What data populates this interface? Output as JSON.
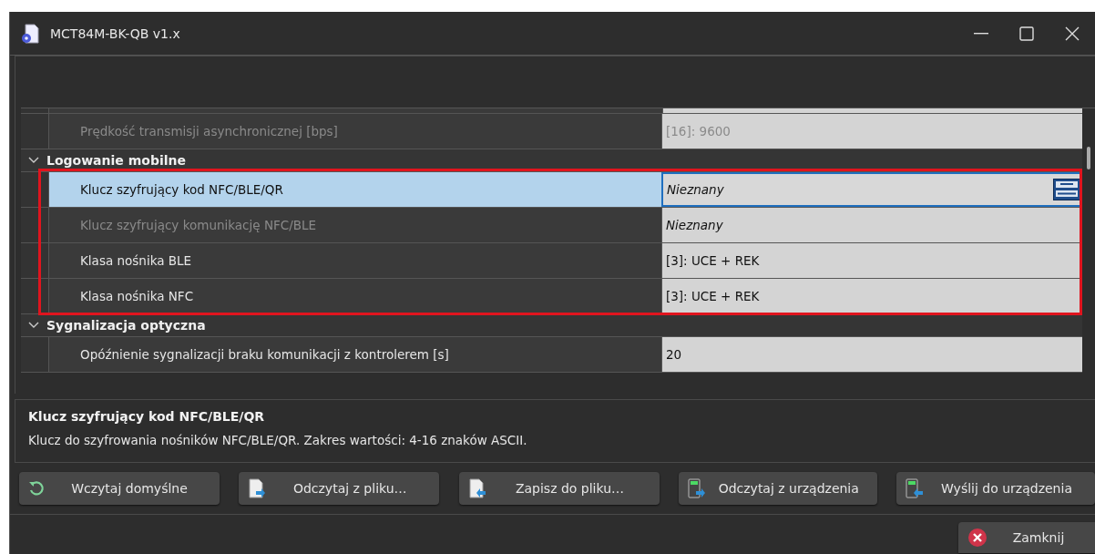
{
  "window": {
    "title": "MCT84M-BK-QB v1.x"
  },
  "grid": {
    "rows": [
      {
        "kind": "property",
        "label": "Prędkość transmisji asynchronicznej [bps]",
        "value": "[16]: 9600",
        "disabled": true,
        "selected": false,
        "unset": false
      },
      {
        "kind": "category",
        "label": "Logowanie mobilne",
        "expanded": true,
        "children": [
          {
            "kind": "property",
            "label": "Klucz szyfrujący kod NFC/BLE/QR",
            "value": "Nieznany",
            "disabled": false,
            "selected": true,
            "unset": true
          },
          {
            "kind": "property",
            "label": "Klucz szyfrujący komunikację NFC/BLE",
            "value": "Nieznany",
            "disabled": true,
            "selected": false,
            "unset": true
          },
          {
            "kind": "property",
            "label": "Klasa nośnika BLE",
            "value": "[3]: UCE + REK",
            "disabled": false,
            "selected": false,
            "unset": false
          },
          {
            "kind": "property",
            "label": "Klasa nośnika NFC",
            "value": "[3]: UCE + REK",
            "disabled": false,
            "selected": false,
            "unset": false
          }
        ]
      },
      {
        "kind": "category",
        "label": "Sygnalizacja optyczna",
        "expanded": true,
        "children": [
          {
            "kind": "property",
            "label": "Opóźnienie sygnalizacji braku komunikacji z kontrolerem [s]",
            "value": "20",
            "disabled": false,
            "selected": false,
            "unset": false
          }
        ]
      }
    ]
  },
  "description": {
    "title": "Klucz szyfrujący kod NFC/BLE/QR",
    "text": "Klucz do szyfrowania nośników NFC/BLE/QR. Zakres wartości: 4-16 znaków ASCII."
  },
  "buttons": [
    {
      "kind": "reset",
      "label": "Wczytaj domyślne"
    },
    {
      "kind": "file-open",
      "label": "Odczytaj z pliku…"
    },
    {
      "kind": "file-save",
      "label": "Zapisz do pliku…"
    },
    {
      "kind": "device-read",
      "label": "Odczytaj z urządzenia"
    },
    {
      "kind": "device-write",
      "label": "Wyślij do urządzenia"
    }
  ],
  "close_button": {
    "label": "Zamknij"
  }
}
